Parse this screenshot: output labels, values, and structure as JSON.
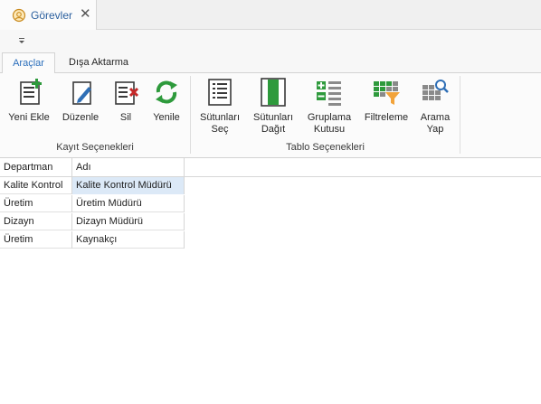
{
  "doc_tab": {
    "title": "Görevler"
  },
  "ribbon": {
    "tabs": [
      {
        "label": "Araçlar"
      },
      {
        "label": "Dışa Aktarma"
      }
    ],
    "groups": [
      {
        "label": "Kayıt Seçenekleri",
        "buttons": [
          {
            "label": "Yeni Ekle",
            "icon": "add-record-icon"
          },
          {
            "label": "Düzenle",
            "icon": "edit-icon"
          },
          {
            "label": "Sil",
            "icon": "delete-icon"
          },
          {
            "label": "Yenile",
            "icon": "refresh-icon"
          }
        ]
      },
      {
        "label": "Tablo Seçenekleri",
        "buttons": [
          {
            "label_line1": "Sütunları",
            "label_line2": "Seç",
            "icon": "column-chooser-icon"
          },
          {
            "label_line1": "Sütunları",
            "label_line2": "Dağıt",
            "icon": "best-fit-icon"
          },
          {
            "label_line1": "Gruplama",
            "label_line2": "Kutusu",
            "icon": "group-panel-icon"
          },
          {
            "label": "Filtreleme",
            "icon": "filter-icon"
          },
          {
            "label_line1": "Arama",
            "label_line2": "Yap",
            "icon": "find-icon"
          }
        ]
      }
    ]
  },
  "grid": {
    "columns": [
      "Departman",
      "Adı"
    ],
    "rows": [
      [
        "Kalite Kontrol",
        "Kalite Kontrol Müdürü"
      ],
      [
        "Üretim",
        "Üretim Müdürü"
      ],
      [
        "Dizayn",
        "Dizayn Müdürü"
      ],
      [
        "Üretim",
        "Kaynakçı"
      ]
    ]
  },
  "colors": {
    "accent": "#2a6ebb",
    "selection": "#dce9f7",
    "green": "#2e9a3c",
    "red": "#c62828"
  }
}
